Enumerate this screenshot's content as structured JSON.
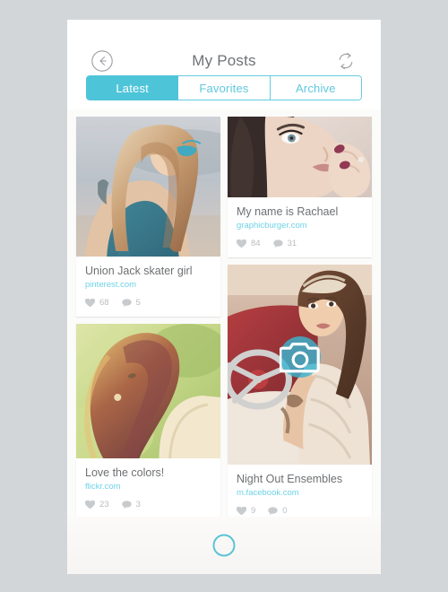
{
  "app": {
    "title": "My Posts",
    "background_color": "#d2d6d9",
    "accent_color": "#4ec4d9",
    "link_color": "#6fd2e6"
  },
  "header": {
    "title": "My Posts",
    "back_icon": "back-arrow-circle-icon",
    "refresh_icon": "refresh-sync-icon"
  },
  "tabs": [
    {
      "label": "Latest",
      "active": true
    },
    {
      "label": "Favorites",
      "active": false
    },
    {
      "label": "Archive",
      "active": false
    }
  ],
  "fab": {
    "icon": "camera-icon",
    "label": "Add photo"
  },
  "posts": [
    {
      "title": "Union Jack skater girl",
      "source": "pinterest.com",
      "likes": "68",
      "comments": "5",
      "image_alt": "Blonde woman with teal sunglasses and tattoo on beach"
    },
    {
      "title": "My name is Rachael",
      "source": "graphicburger.com",
      "likes": "84",
      "comments": "31",
      "image_alt": "Close-up portrait of dark-haired woman with hand at lips"
    },
    {
      "title": "Love the colors!",
      "source": "flickr.com",
      "likes": "23",
      "comments": "3",
      "image_alt": "Red-haired woman in sunlit green field"
    },
    {
      "title": "Night Out Ensembles",
      "source": "m.facebook.com",
      "likes": "9",
      "comments": "0",
      "image_alt": "Woman in vintage car holding sunglasses"
    }
  ],
  "bottom": {
    "home_button": "home-button"
  }
}
